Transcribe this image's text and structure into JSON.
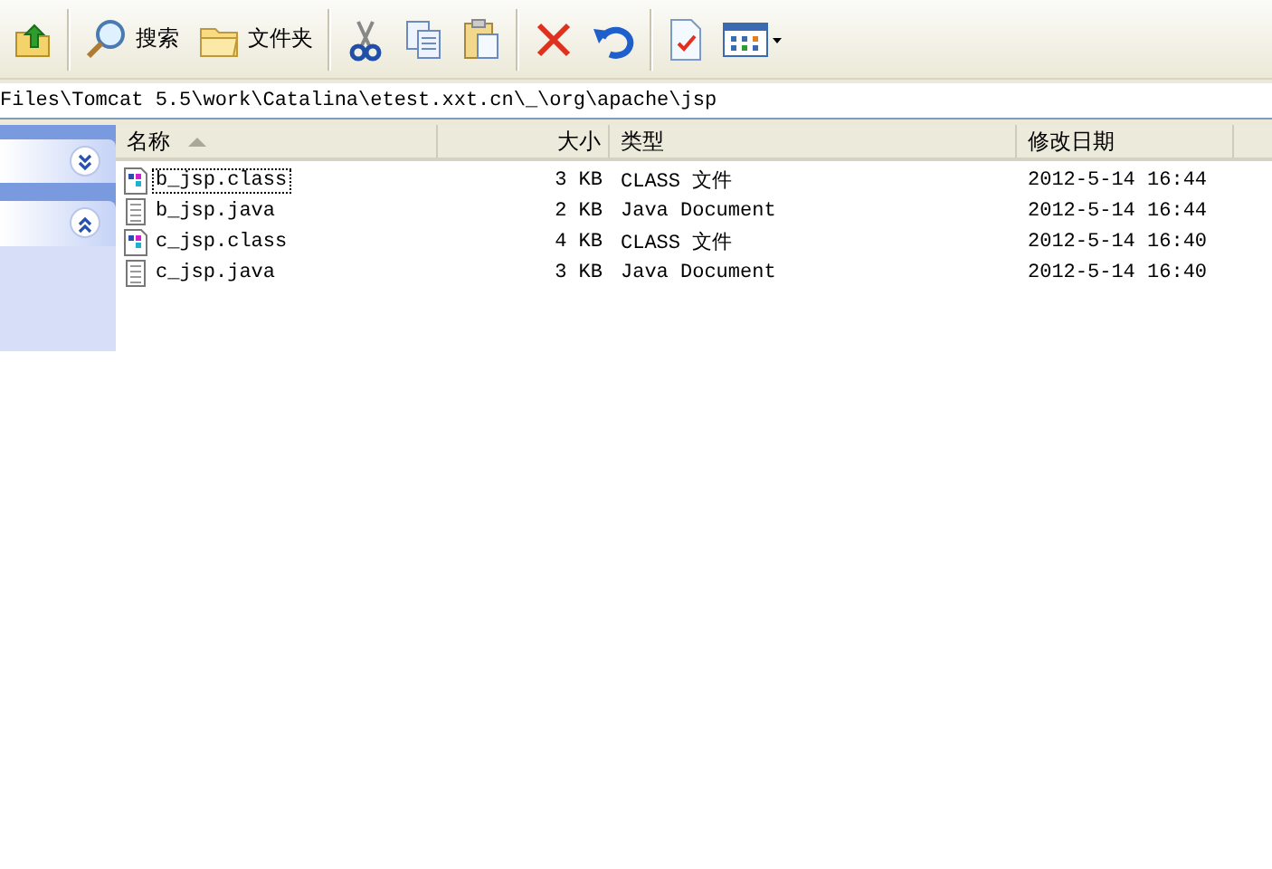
{
  "toolbar": {
    "buttons": [
      {
        "kind": "up"
      },
      {
        "kind": "search",
        "label": "搜索"
      },
      {
        "kind": "folders",
        "label": "文件夹"
      },
      {
        "kind": "cut"
      },
      {
        "kind": "copy"
      },
      {
        "kind": "paste"
      },
      {
        "kind": "delete"
      },
      {
        "kind": "undo"
      },
      {
        "kind": "properties"
      },
      {
        "kind": "views"
      }
    ]
  },
  "address": {
    "value": "Files\\Tomcat 5.5\\work\\Catalina\\etest.xxt.cn\\_\\org\\apache\\jsp"
  },
  "sidebar": {
    "panels": [
      {
        "expanded": false
      },
      {
        "expanded": true
      }
    ]
  },
  "table": {
    "columns": [
      {
        "label": "名称",
        "sorted": true
      },
      {
        "label": "大小",
        "sorted": false
      },
      {
        "label": "类型",
        "sorted": false
      },
      {
        "label": "修改日期",
        "sorted": false
      }
    ],
    "rows": [
      {
        "kind": "class",
        "name": "b_jsp.class",
        "size": "3 KB",
        "type": "CLASS 文件",
        "modified": "2012-5-14 16:44",
        "selected": true
      },
      {
        "kind": "java",
        "name": "b_jsp.java",
        "size": "2 KB",
        "type": "Java Document",
        "modified": "2012-5-14 16:44",
        "selected": false
      },
      {
        "kind": "class",
        "name": "c_jsp.class",
        "size": "4 KB",
        "type": "CLASS 文件",
        "modified": "2012-5-14 16:40",
        "selected": false
      },
      {
        "kind": "java",
        "name": "c_jsp.java",
        "size": "3 KB",
        "type": "Java Document",
        "modified": "2012-5-14 16:40",
        "selected": false
      }
    ]
  }
}
